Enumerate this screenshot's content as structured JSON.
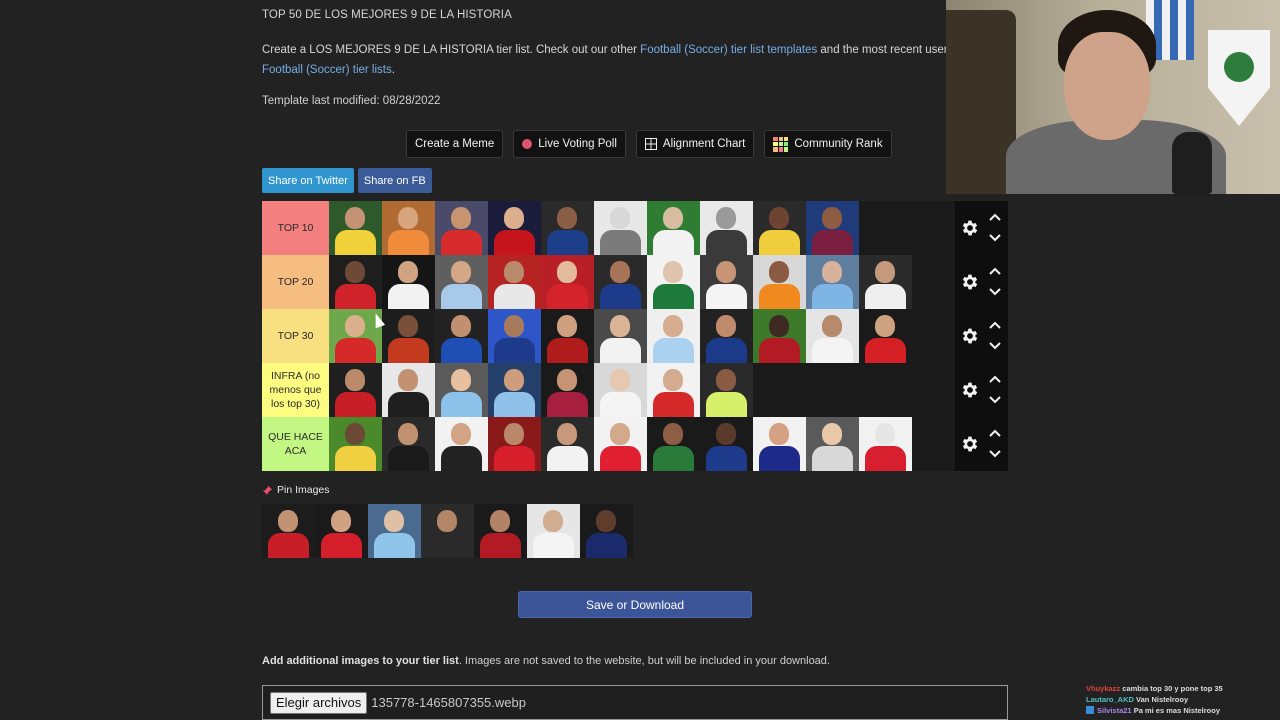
{
  "header": {
    "title": "TOP 50 DE LOS MEJORES 9 DE LA HISTORIA",
    "desc_prefix": "Create a LOS MEJORES 9 DE LA HISTORIA tier list. Check out our other ",
    "desc_link1": "Football (Soccer) tier list templates",
    "desc_middle": " and the most recent user s",
    "desc_link2": "Football (Soccer) tier lists",
    "desc_suffix": ".",
    "modified": "Template last modified: 08/28/2022"
  },
  "toolbar": {
    "create_meme": "Create a Meme",
    "live_voting": "Live Voting Poll",
    "alignment_chart": "Alignment Chart",
    "community_rank": "Community Rank"
  },
  "share": {
    "twitter": "Share on Twitter",
    "facebook": "Share on FB"
  },
  "tiers": [
    {
      "label": "TOP 10",
      "color": "#f47f7f",
      "players": [
        {
          "skin": "#c69276",
          "shirt": "#f1d23a",
          "bg": "#2e5a2b"
        },
        {
          "skin": "#d7a47e",
          "shirt": "#ef8b3a",
          "bg": "#b26a33"
        },
        {
          "skin": "#c8946f",
          "shirt": "#d82c2c",
          "bg": "#4a4a6a"
        },
        {
          "skin": "#dcae8e",
          "shirt": "#c5141c",
          "bg": "#1b1b3b"
        },
        {
          "skin": "#8a5e45",
          "shirt": "#1d3f8a",
          "bg": "#2a2a2a"
        },
        {
          "skin": "#d8d8d8",
          "shirt": "#7b7b7b",
          "bg": "#e8e8e8"
        },
        {
          "skin": "#d8bca2",
          "shirt": "#f2f2f2",
          "bg": "#2e7d32"
        },
        {
          "skin": "#9a9a9a",
          "shirt": "#3a3a3a",
          "bg": "#e9e9e9"
        },
        {
          "skin": "#6d4432",
          "shirt": "#f0cd3c",
          "bg": "#2a2a2a"
        },
        {
          "skin": "#8d5c43",
          "shirt": "#7a1f3f",
          "bg": "#1f3b7a"
        }
      ]
    },
    {
      "label": "TOP 20",
      "color": "#f6bd81",
      "players": [
        {
          "skin": "#6e4a36",
          "shirt": "#d0222a",
          "bg": "#1e1e1e"
        },
        {
          "skin": "#d0a482",
          "shirt": "#f2f2f2",
          "bg": "#151515"
        },
        {
          "skin": "#d4a886",
          "shirt": "#a9c9ea",
          "bg": "#5f5f5f"
        },
        {
          "skin": "#ba8a6c",
          "shirt": "#e8e8e8",
          "bg": "#b52323"
        },
        {
          "skin": "#e4ba9c",
          "shirt": "#d4232a",
          "bg": "#b81f26"
        },
        {
          "skin": "#a87356",
          "shirt": "#1e3a8a",
          "bg": "#2a2a2a"
        },
        {
          "skin": "#e0c4ae",
          "shirt": "#1e7a3a",
          "bg": "#f3f3f3"
        },
        {
          "skin": "#c89476",
          "shirt": "#f4f4f4",
          "bg": "#3a3a3a"
        },
        {
          "skin": "#8a5b40",
          "shirt": "#f08a1e",
          "bg": "#d8d8d8"
        },
        {
          "skin": "#d7b29a",
          "shirt": "#7fb5e5",
          "bg": "#5f7fa0"
        },
        {
          "skin": "#c49a7a",
          "shirt": "#efefef",
          "bg": "#2a2a2a"
        }
      ]
    },
    {
      "label": "TOP 30",
      "color": "#f8df80",
      "players": [
        {
          "skin": "#dbb08c",
          "shirt": "#d62a2a",
          "bg": "#6fa84a"
        },
        {
          "skin": "#7a4f3a",
          "shirt": "#c33a1e",
          "bg": "#1d1d1d"
        },
        {
          "skin": "#c19070",
          "shirt": "#1f4fb5",
          "bg": "#222222"
        },
        {
          "skin": "#a87a5c",
          "shirt": "#1e3a8a",
          "bg": "#2f56c8"
        },
        {
          "skin": "#cfa080",
          "shirt": "#b01c1c",
          "bg": "#1a1a1a"
        },
        {
          "skin": "#dbb496",
          "shirt": "#f2f2f2",
          "bg": "#4a4a4a"
        },
        {
          "skin": "#d6ad90",
          "shirt": "#aad1f0",
          "bg": "#efefef"
        },
        {
          "skin": "#c08a6c",
          "shirt": "#1b3a8a",
          "bg": "#222222"
        },
        {
          "skin": "#3e2a22",
          "shirt": "#b21a24",
          "bg": "#3c7a2a"
        },
        {
          "skin": "#b88a6c",
          "shirt": "#f4f4f4",
          "bg": "#e5e5e5"
        },
        {
          "skin": "#cea17f",
          "shirt": "#d41f25",
          "bg": "#1a1a1a"
        }
      ]
    },
    {
      "label": "INFRA (no menos que los top 30)",
      "color": "#fdfc80",
      "players": [
        {
          "skin": "#bb8a6a",
          "shirt": "#c81e28",
          "bg": "#1f1f1f"
        },
        {
          "skin": "#c29272",
          "shirt": "#1f1f1f",
          "bg": "#e8e8e8"
        },
        {
          "skin": "#e6c0a0",
          "shirt": "#8cc2ea",
          "bg": "#5a5a5a"
        },
        {
          "skin": "#cf9c7c",
          "shirt": "#8fc1ea",
          "bg": "#24406a"
        },
        {
          "skin": "#c59474",
          "shirt": "#a71f3f",
          "bg": "#1a1a1a"
        },
        {
          "skin": "#e6c8b0",
          "shirt": "#f4f4f4",
          "bg": "#d8d8d8"
        },
        {
          "skin": "#d4ab8f",
          "shirt": "#d62a2a",
          "bg": "#f2f2f2"
        },
        {
          "skin": "#8a5a42",
          "shirt": "#d7f06a",
          "bg": "#2a2a2a"
        }
      ]
    },
    {
      "label": "QUE HACE ACA",
      "color": "#c3f784",
      "players": [
        {
          "skin": "#6a4a34",
          "shirt": "#f0d040",
          "bg": "#4a8a2a"
        },
        {
          "skin": "#c19272",
          "shirt": "#1a1a1a",
          "bg": "#2a2a2a"
        },
        {
          "skin": "#d2a384",
          "shirt": "#222222",
          "bg": "#f2f2f2"
        },
        {
          "skin": "#b9876a",
          "shirt": "#d61f2a",
          "bg": "#8a1a1a"
        },
        {
          "skin": "#c8987a",
          "shirt": "#f2f2f2",
          "bg": "#2a2a2a"
        },
        {
          "skin": "#d4a88a",
          "shirt": "#e02030",
          "bg": "#f2f2f2"
        },
        {
          "skin": "#8d5e44",
          "shirt": "#2a7a3a",
          "bg": "#1a1a1a"
        },
        {
          "skin": "#5a3a2a",
          "shirt": "#1e3a8a",
          "bg": "#1a1a1a"
        },
        {
          "skin": "#d4a282",
          "shirt": "#1e2a8a",
          "bg": "#f2f2f2"
        },
        {
          "skin": "#e8c8a8",
          "shirt": "#d8d8d8",
          "bg": "#5a5a5a"
        },
        {
          "skin": "#e6e6e6",
          "shirt": "#d81f2f",
          "bg": "#f2f2f2"
        }
      ]
    }
  ],
  "pin": {
    "label": "Pin Images",
    "players": [
      {
        "skin": "#c29274",
        "shirt": "#c81e28",
        "bg": "#1c1c1c"
      },
      {
        "skin": "#d0a282",
        "shirt": "#d41f2a",
        "bg": "#1a1a1a"
      },
      {
        "skin": "#dfc0a4",
        "shirt": "#8fc5ea",
        "bg": "#4a6a90"
      },
      {
        "skin": "#b48668",
        "shirt": "#2a2a2a",
        "bg": "#2a2a2a"
      },
      {
        "skin": "#b38366",
        "shirt": "#b21a24",
        "bg": "#1a1a1a"
      },
      {
        "skin": "#d2ac8e",
        "shirt": "#f4f4f4",
        "bg": "#e6e6e6"
      },
      {
        "skin": "#5e3d2c",
        "shirt": "#1b2a6a",
        "bg": "#1a1a1a"
      }
    ]
  },
  "save_button": "Save or Download",
  "add_images": {
    "bold": "Add additional images to your tier list",
    "rest": ". Images are not saved to the website, but will be included in your download."
  },
  "file_input": {
    "button": "Elegir archivos",
    "filename": "135778-1465807355.webp"
  },
  "chat": [
    {
      "user": "Vhuykazz",
      "text": "cambia top 30 y pone top 35",
      "color": "#e0413d"
    },
    {
      "user": "Lautaro_AKD",
      "text": "Van Nistelrooy",
      "color": "#4fc0c8"
    },
    {
      "user": "Silvista21",
      "text": "Pa mi es mas Nistelrooy",
      "color": "#a886e8"
    }
  ]
}
